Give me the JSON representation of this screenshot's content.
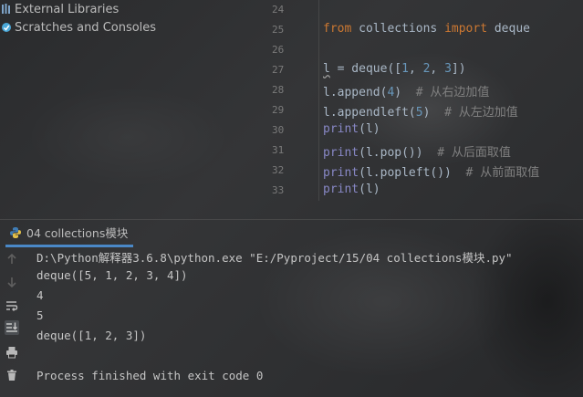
{
  "project_tree": {
    "items": [
      {
        "label": "External Libraries",
        "icon": "external-libraries-icon"
      },
      {
        "label": "Scratches and Consoles",
        "icon": "scratches-icon"
      }
    ]
  },
  "editor": {
    "line_numbers": [
      "24",
      "25",
      "26",
      "27",
      "28",
      "29",
      "30",
      "31",
      "32",
      "33"
    ],
    "lines": [
      "",
      "from collections import deque",
      "",
      "l = deque([1, 2, 3])",
      "l.append(4)  # 从右边加值",
      "l.appendleft(5)  # 从左边加值",
      "print(l)",
      "print(l.pop())  # 从后面取值",
      "print(l.popleft())  # 从前面取值",
      "print(l)"
    ]
  },
  "run": {
    "tab_label": "04 collections模块",
    "output": [
      "D:\\Python解释器3.6.8\\python.exe \"E:/Pyproject/15/04 collections模块.py\"",
      "deque([5, 1, 2, 3, 4])",
      "4",
      "5",
      "deque([1, 2, 3])",
      "",
      "Process finished with exit code 0"
    ],
    "toolbar_icons": [
      "up-arrow-icon",
      "down-arrow-icon",
      "soft-wrap-icon",
      "scroll-to-end-icon",
      "print-icon",
      "trash-icon"
    ]
  },
  "colors": {
    "keyword": "#cc7832",
    "number": "#6897bb",
    "comment": "#808080",
    "builtin": "#8888c6",
    "tab_underline": "#4a88c7"
  }
}
